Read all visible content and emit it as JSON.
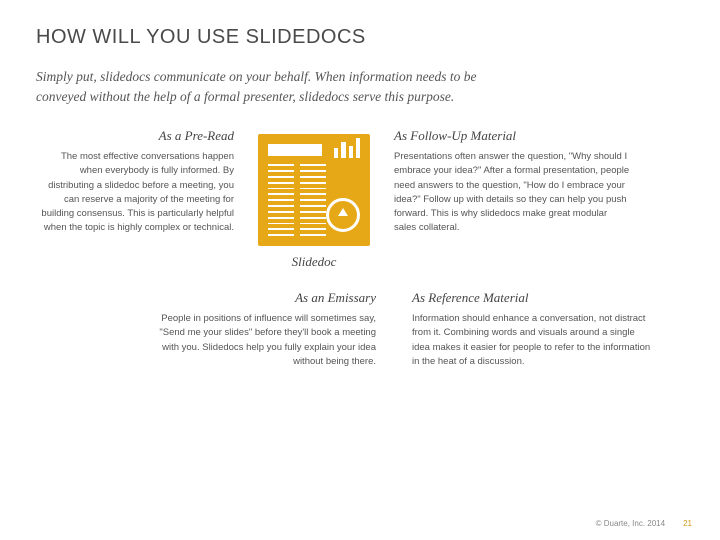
{
  "title": "HOW WILL YOU USE SLIDEDOCS",
  "intro": "Simply put, slidedocs communicate on your behalf. When information needs to be conveyed without the help of a formal presenter, slidedocs serve this purpose.",
  "center_label": "Slidedoc",
  "quadrants": {
    "pre_read": {
      "heading": "As a Pre-Read",
      "body": "The most effective conversations happen when everybody is fully informed. By distributing a slidedoc before a meeting, you can reserve a majority of the meeting for building consensus. This is particularly helpful when the topic is highly complex or technical."
    },
    "follow_up": {
      "heading": "As Follow-Up Material",
      "body": "Presentations often answer the question, \"Why should I embrace your idea?\" After a formal presentation, people need answers to the question, \"How do I embrace your idea?\" Follow up with details so they can help you push forward. This is why slidedocs make great modular sales collateral."
    },
    "emissary": {
      "heading": "As an Emissary",
      "body": "People in positions of influence will sometimes say, \"Send me your slides\" before they'll book a meeting with you. Slidedocs help you fully explain your idea without being there."
    },
    "reference": {
      "heading": "As Reference Material",
      "body": "Information should enhance a conversation, not distract from it. Combining words and visuals around a single idea makes it easier for people to refer to the information in the heat of a discussion."
    }
  },
  "footer": {
    "copyright": "© Duarte, Inc. 2014",
    "page": "21"
  }
}
